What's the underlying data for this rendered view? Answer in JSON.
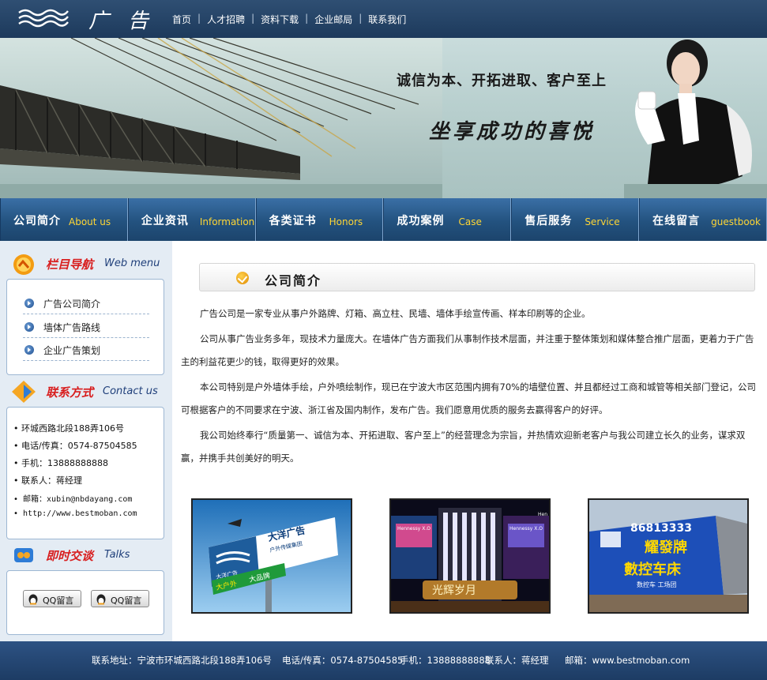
{
  "header": {
    "logo_text": "广告",
    "nav": [
      "首页",
      "人才招聘",
      "资料下载",
      "企业邮局",
      "联系我们"
    ]
  },
  "banner": {
    "slogan1": "诚信为本、开拓进取、客户至上",
    "slogan2": "坐享成功的喜悦"
  },
  "main_nav": [
    {
      "cn": "公司简介",
      "en": "About us"
    },
    {
      "cn": "企业资讯",
      "en": "Information"
    },
    {
      "cn": "各类证书",
      "en": "Honors"
    },
    {
      "cn": "成功案例",
      "en": "Case"
    },
    {
      "cn": "售后服务",
      "en": "Service"
    },
    {
      "cn": "在线留言",
      "en": "guestbook"
    }
  ],
  "sidebar": {
    "menu": {
      "title_cn": "栏目导航",
      "title_en": "Web menu",
      "items": [
        "广告公司简介",
        "墙体广告路线",
        "企业广告策划"
      ]
    },
    "contact": {
      "title_cn": "联系方式",
      "title_en": "Contact us",
      "lines": [
        "• 环城西路北段188弄106号",
        "• 电话/传真：0574-87504585",
        "• 手机：13888888888",
        "• 联系人：蒋经理",
        "• 邮箱：xubin@nbdayang.com",
        "• http://www.bestmoban.com"
      ]
    },
    "talks": {
      "title_cn": "即时交谈",
      "title_en": "Talks",
      "buttons": [
        "QQ留言",
        "QQ留言"
      ]
    }
  },
  "content": {
    "section_title": "公司简介",
    "paragraphs": [
      "广告公司是一家专业从事户外路牌、灯箱、高立柱、民墙、墙体手绘宣传画、样本印刷等的企业。",
      "公司从事广告业务多年，现技术力量庞大。在墙体广告方面我们从事制作技术层面，并注重于整体策划和媒体整合推广层面，更着力于广告主的利益花更少的钱，取得更好的效果。",
      "本公司特别是户外墙体手绘，户外喷绘制作，现已在宁波大市区范围内拥有70%的墙壁位置、并且都经过工商和城管等相关部门登记，公司可根据客户的不同要求在宁波、浙江省及国内制作，发布广告。我们愿意用优质的服务去赢得客户的好评。",
      "我公司始终奉行“质量第一、诚信为本、开拓进取、客户至上”的经营理念为宗旨，并热情欢迎新老客户与我公司建立长久的业务，谋求双赢，并携手共创美好的明天。"
    ],
    "photos": [
      {
        "text1": "大洋广告",
        "text2": "户外传媒集团",
        "text3": "大洋广告",
        "text4": "大户外",
        "text5": "大品牌"
      },
      {
        "text1": "光辉岁月",
        "text2": "Hennessy X.O",
        "text3": "Hennessy X.O",
        "text4": "Hen"
      },
      {
        "text1": "86813333",
        "text2": "耀發牌",
        "text3": "數控车床",
        "text4": "数控车 工场团"
      }
    ]
  },
  "footer": {
    "address": "联系地址：宁波市环城西路北段188弄106号",
    "phone": "电话/传真：0574-87504585",
    "mobile": "手机：13888888888",
    "contact": "联系人：蒋经理",
    "email": "邮箱：www.bestmoban.com"
  }
}
